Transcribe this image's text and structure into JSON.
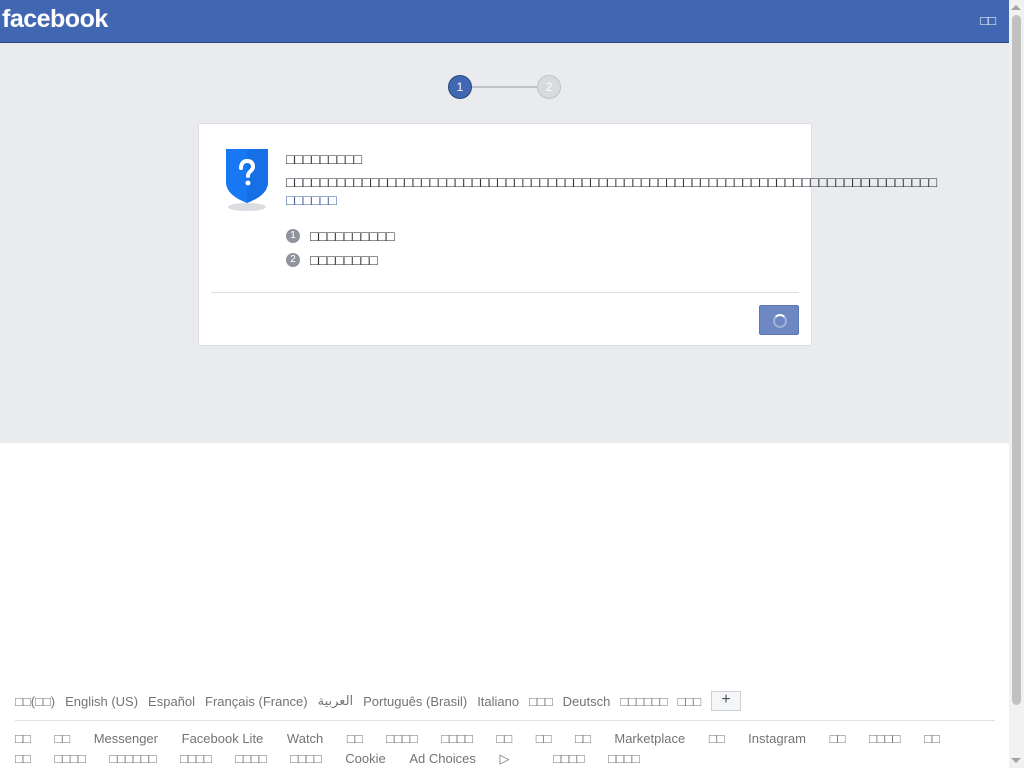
{
  "header": {
    "logo": "facebook",
    "right_text": "□□"
  },
  "stepper": {
    "step1": "1",
    "step2": "2"
  },
  "card": {
    "title": "□□□□□□□□□",
    "description": "□□□□□□□□□□□□□□□□□□□□□□□□□□□□□□□□□□□□□□□□□□□□□□□□□□□□□□□□□□□□□□□□□□□□□□□□□□□□□",
    "learn_more": "□□□□□□",
    "items": [
      {
        "num": "1",
        "label": "□□□□□□□□□□"
      },
      {
        "num": "2",
        "label": "□□□□□□□□"
      }
    ]
  },
  "footer": {
    "languages": [
      "□□(□□)",
      "English (US)",
      "Español",
      "Français (France)",
      "العربية",
      "Português (Brasil)",
      "Italiano",
      "□□□",
      "Deutsch",
      "□□□□□□",
      "□□□"
    ],
    "plus": "+",
    "links": [
      "□□",
      "□□",
      "Messenger",
      "Facebook Lite",
      "Watch",
      "□□",
      "□□□□",
      "□□□□",
      "□□",
      "□□",
      "□□",
      "Marketplace",
      "□□",
      "Instagram",
      "□□",
      "□□□□",
      "□□",
      "□□",
      "□□□□",
      "□□□□□□",
      "□□□□",
      "□□□□",
      "□□□□",
      "Cookie",
      "Ad Choices",
      "□□□□",
      "□□□□"
    ]
  },
  "colors": {
    "topbar": "#4267b2",
    "background": "#e9ebee",
    "accent": "#4267b2",
    "link": "#365899"
  }
}
